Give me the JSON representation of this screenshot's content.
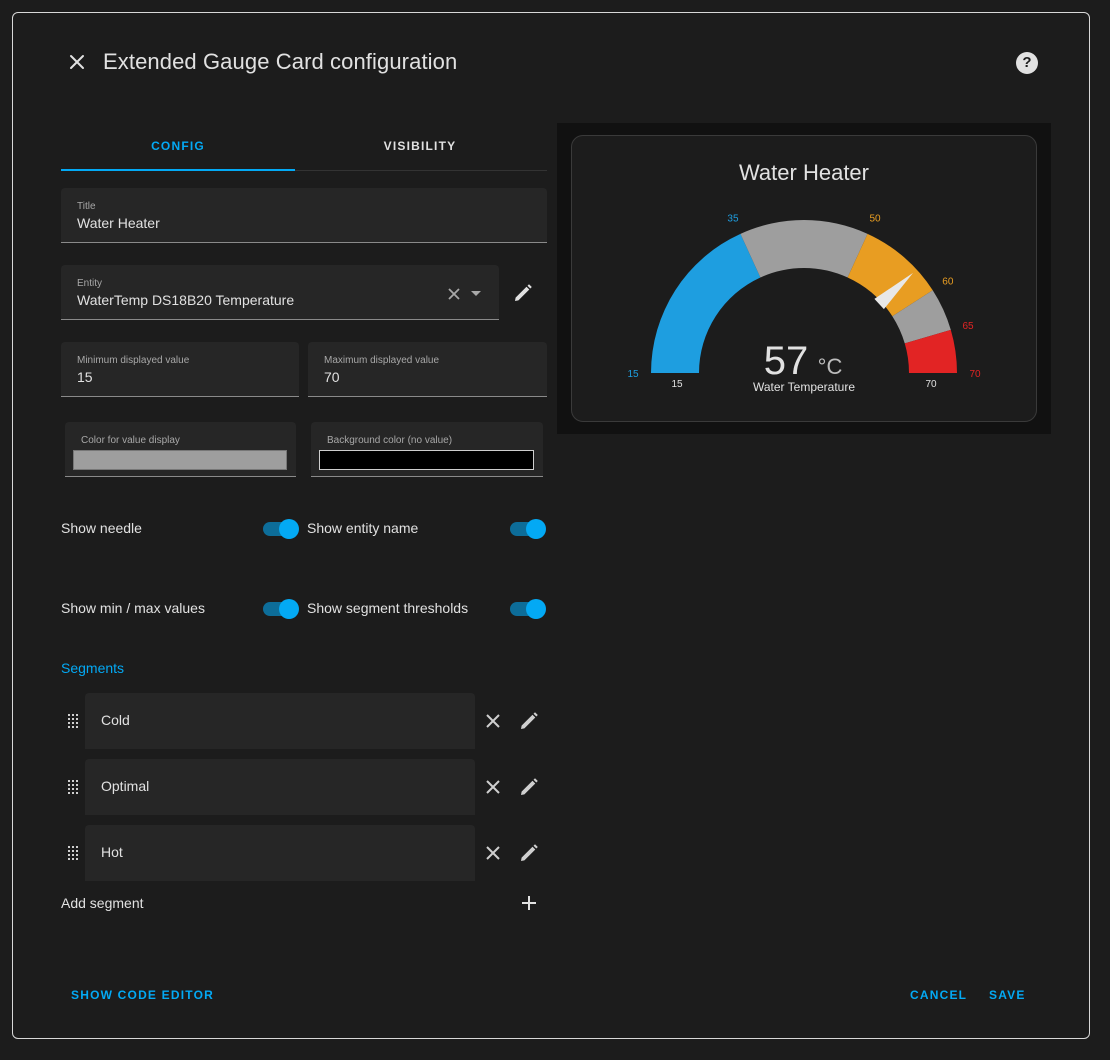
{
  "dialog": {
    "title": "Extended Gauge Card configuration",
    "help_glyph": "?"
  },
  "tabs": [
    {
      "label": "CONFIG",
      "active": true
    },
    {
      "label": "VISIBILITY",
      "active": false
    }
  ],
  "fields": {
    "title": {
      "label": "Title",
      "value": "Water Heater"
    },
    "entity": {
      "label": "Entity",
      "value": "WaterTemp DS18B20 Temperature"
    },
    "min": {
      "label": "Minimum displayed value",
      "value": "15"
    },
    "max": {
      "label": "Maximum displayed value",
      "value": "70"
    },
    "value_color": {
      "label": "Color for value display",
      "color": "#9e9e9e"
    },
    "bg_color": {
      "label": "Background color (no value)",
      "color": "#000000"
    }
  },
  "options": {
    "show_needle": {
      "label": "Show needle",
      "on": true
    },
    "show_entity_name": {
      "label": "Show entity name",
      "on": true
    },
    "show_min_max": {
      "label": "Show min / max values",
      "on": true
    },
    "show_segment_thresholds": {
      "label": "Show segment thresholds",
      "on": true
    }
  },
  "segments": {
    "title": "Segments",
    "items": [
      {
        "label": "Cold"
      },
      {
        "label": "Optimal"
      },
      {
        "label": "Hot"
      }
    ],
    "add_label": "Add segment"
  },
  "footer": {
    "code_editor": "SHOW CODE EDITOR",
    "cancel": "CANCEL",
    "save": "SAVE"
  },
  "preview": {
    "title": "Water Heater",
    "value": "57",
    "unit": "°C",
    "entity_name": "Water Temperature",
    "min_label": "15",
    "max_label": "70",
    "min": 15,
    "max": 70,
    "needle_value": 57,
    "segments": [
      {
        "from": 15,
        "to": 35,
        "color": "#1e9ee0"
      },
      {
        "from": 35,
        "to": 50,
        "color": "#9e9e9e"
      },
      {
        "from": 50,
        "to": 60,
        "color": "#e89d22"
      },
      {
        "from": 60,
        "to": 65,
        "color": "#9e9e9e"
      },
      {
        "from": 65,
        "to": 70,
        "color": "#e22424"
      }
    ],
    "thresholds": [
      {
        "value": 15,
        "label": "15",
        "color": "#1e9ee0"
      },
      {
        "value": 35,
        "label": "35",
        "color": "#1e9ee0"
      },
      {
        "value": 50,
        "label": "50",
        "color": "#e89d22"
      },
      {
        "value": 60,
        "label": "60",
        "color": "#e89d22"
      },
      {
        "value": 65,
        "label": "65",
        "color": "#e22424"
      },
      {
        "value": 70,
        "label": "70",
        "color": "#e22424"
      }
    ]
  },
  "colors": {
    "accent": "#03a9f4",
    "background": "#1c1c1c"
  }
}
